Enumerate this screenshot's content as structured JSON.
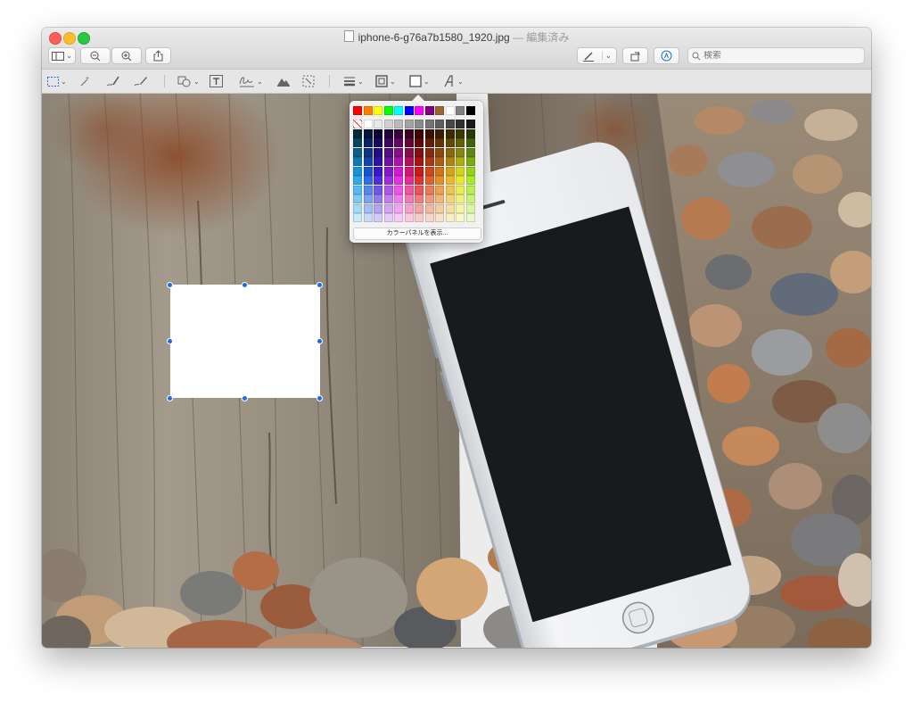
{
  "window": {
    "title": "iphone-6-g76a7b1580_1920.jpg",
    "edited_status": " — 編集済み"
  },
  "toolbar": {
    "search_placeholder": "検索",
    "search_value": ""
  },
  "color_panel": {
    "show_panel_label": "カラーパネルを表示...",
    "top_row_colors": [
      "#ff0000",
      "#ff8000",
      "#ffff00",
      "#00ff00",
      "#00ffff",
      "#0000ff",
      "#ff00ff",
      "#800080",
      "#996633",
      "#ffffff",
      "#808080",
      "#000000"
    ]
  },
  "colors": {
    "selection_handle": "#1a6fe0",
    "rectangle_fill": "#ffffff"
  }
}
